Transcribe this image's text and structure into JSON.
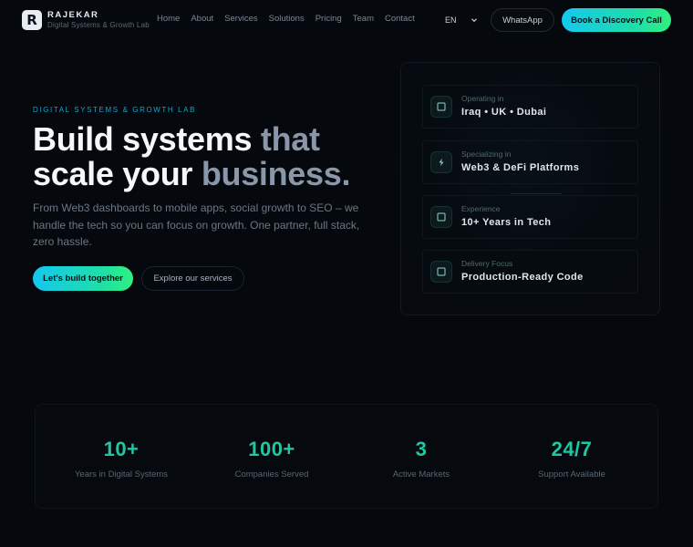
{
  "brand": {
    "logo_letter": "R",
    "name": "RAJEKAR",
    "tagline": "Digital Systems & Growth Lab"
  },
  "nav": {
    "links": [
      "Home",
      "About",
      "Services",
      "Solutions",
      "Pricing",
      "Team",
      "Contact"
    ],
    "language": "EN",
    "whatsapp_label": "WhatsApp",
    "cta_label": "Book a Discovery Call"
  },
  "hero": {
    "eyebrow": "DIGITAL SYSTEMS & GROWTH LAB",
    "headline_line1_a": "Build systems ",
    "headline_line1_b": "that",
    "headline_line2_a": "scale your ",
    "headline_line2_b": "business.",
    "description": "From Web3 dashboards to mobile apps, social growth to SEO – we handle the tech so you can focus on growth. One partner, full stack, zero hassle.",
    "primary_button": "Let's build together",
    "secondary_button": "Explore our services"
  },
  "info_card": {
    "items": [
      {
        "label": "Operating in",
        "value": "Iraq • UK • Dubai",
        "icon": "square-icon"
      },
      {
        "label": "Specializing in",
        "value": "Web3 & DeFi Platforms",
        "icon": "lightning-icon"
      },
      {
        "label": "Experience",
        "value": "10+ Years in Tech",
        "icon": "square-icon"
      },
      {
        "label": "Delivery Focus",
        "value": "Production-Ready Code",
        "icon": "square-icon"
      }
    ]
  },
  "stats": [
    {
      "value": "10+",
      "label": "Years in Digital Systems"
    },
    {
      "value": "100+",
      "label": "Companies Served"
    },
    {
      "value": "3",
      "label": "Active Markets"
    },
    {
      "value": "24/7",
      "label": "Support Available"
    }
  ],
  "colors": {
    "background": "#05080d",
    "accent_start": "#14c8ee",
    "accent_end": "#31f07f",
    "stat_number": "#1fc7a2",
    "eyebrow": "#1aa3c4"
  }
}
